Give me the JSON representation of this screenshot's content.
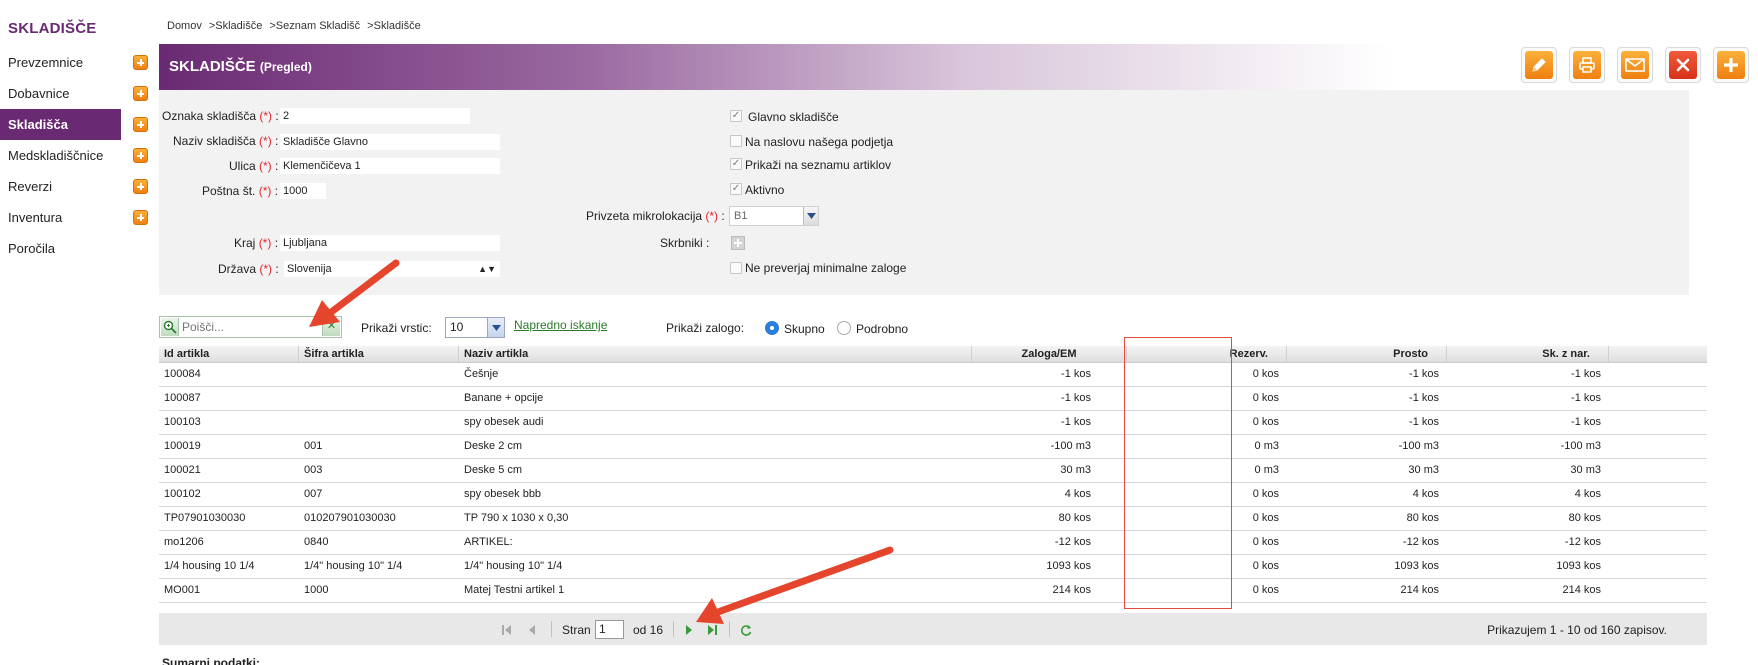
{
  "app": {
    "title": "SKLADIŠČE"
  },
  "sidebar": {
    "items": [
      {
        "label": "Prevzemnice",
        "add": true
      },
      {
        "label": "Dobavnice",
        "add": true
      },
      {
        "label": "Skladišča",
        "add": true,
        "active": true
      },
      {
        "label": "Medskladiščnice",
        "add": true
      },
      {
        "label": "Reverzi",
        "add": true
      },
      {
        "label": "Inventura",
        "add": true
      },
      {
        "label": "Poročila",
        "add": false
      }
    ]
  },
  "breadcrumb": [
    "Domov",
    "Skladišče",
    "Seznam Skladišč",
    "Skladišče"
  ],
  "breadcrumb_separator": ">",
  "header": {
    "title": "SKLADIŠČE",
    "subtitle": "(Pregled)"
  },
  "toolbar": {
    "edit_icon": "pencil-icon",
    "print_icon": "printer-icon",
    "email_icon": "envelope-icon",
    "delete_icon": "close-icon",
    "add_icon": "plus-icon"
  },
  "form": {
    "required_marker": "(*)",
    "oznaka": {
      "label": "Oznaka skladišča",
      "value": "2"
    },
    "naziv": {
      "label": "Naziv skladišča",
      "value": "Skladišče Glavno"
    },
    "ulica": {
      "label": "Ulica",
      "value": "Klemenčičeva 1"
    },
    "posta": {
      "label": "Poštna št.",
      "value": "1000"
    },
    "kraj": {
      "label": "Kraj",
      "value": "Ljubljana"
    },
    "drzava": {
      "label": "Država",
      "value": "Slovenija"
    },
    "glavno": {
      "label": "Glavno skladišče",
      "checked": true
    },
    "naslov": {
      "label": "Na naslovu našega podjetja",
      "checked": false
    },
    "prikazi": {
      "label": "Prikaži na seznamu artiklov",
      "checked": true
    },
    "aktivno": {
      "label": "Aktivno",
      "checked": true
    },
    "mikrolokacija": {
      "label": "Privzeta mikrolokacija",
      "value": "B1"
    },
    "skrbniki": {
      "label": "Skrbniki :"
    },
    "minimalne": {
      "label": "Ne preverjaj minimalne zaloge",
      "checked": false
    }
  },
  "grid_toolbar": {
    "search_placeholder": "Poišči...",
    "rows_label": "Prikaži vrstic:",
    "rows_value": "10",
    "advanced_link": "Napredno iskanje",
    "stock_label": "Prikaži zalogo:",
    "stock_options": [
      "Skupno",
      "Podrobno"
    ],
    "stock_selected": "Skupno"
  },
  "table": {
    "columns": [
      "Id artikla",
      "Šifra artikla",
      "Naziv artikla",
      "Zaloga/EM",
      "Rezerv.",
      "Prosto",
      "Sk. z nar."
    ],
    "rows": [
      [
        "100084",
        "",
        "Češnje",
        "-1 kos",
        "0 kos",
        "-1 kos",
        "-1 kos"
      ],
      [
        "100087",
        "",
        "Banane + opcije",
        "-1 kos",
        "0 kos",
        "-1 kos",
        "-1 kos"
      ],
      [
        "100103",
        "",
        "spy obesek audi",
        "-1 kos",
        "0 kos",
        "-1 kos",
        "-1 kos"
      ],
      [
        "100019",
        "001",
        "Deske 2 cm",
        "-100 m3",
        "0 m3",
        "-100 m3",
        "-100 m3"
      ],
      [
        "100021",
        "003",
        "Deske 5 cm",
        "30 m3",
        "0 m3",
        "30 m3",
        "30 m3"
      ],
      [
        "100102",
        "007",
        "spy obesek bbb",
        "4 kos",
        "0 kos",
        "4 kos",
        "4 kos"
      ],
      [
        "TP07901030030",
        "010207901030030",
        "TP 790 x 1030 x 0,30",
        "80 kos",
        "0 kos",
        "80 kos",
        "80 kos"
      ],
      [
        "mo1206",
        "0840",
        "ARTIKEL:",
        "-12 kos",
        "0 kos",
        "-12 kos",
        "-12 kos"
      ],
      [
        "1/4 housing 10 1/4",
        "1/4\" housing 10\" 1/4",
        "1/4\" housing 10\" 1/4",
        "1093 kos",
        "0 kos",
        "1093 kos",
        "1093 kos"
      ],
      [
        "MO001",
        "1000",
        "Matej Testni artikel 1",
        "214 kos",
        "0 kos",
        "214 kos",
        "214 kos"
      ]
    ]
  },
  "pager": {
    "page_label": "Stran",
    "page_value": "1",
    "of_label": "od 16",
    "info": "Prikazujem 1 - 10 od 160 zapisov."
  },
  "summary": {
    "title": "Sumarni podatki:"
  },
  "colors": {
    "brand": "#6a2a73",
    "accent_orange": "#f39a1f",
    "delete_red": "#e3432a",
    "annotation_red": "#e14a3c"
  }
}
